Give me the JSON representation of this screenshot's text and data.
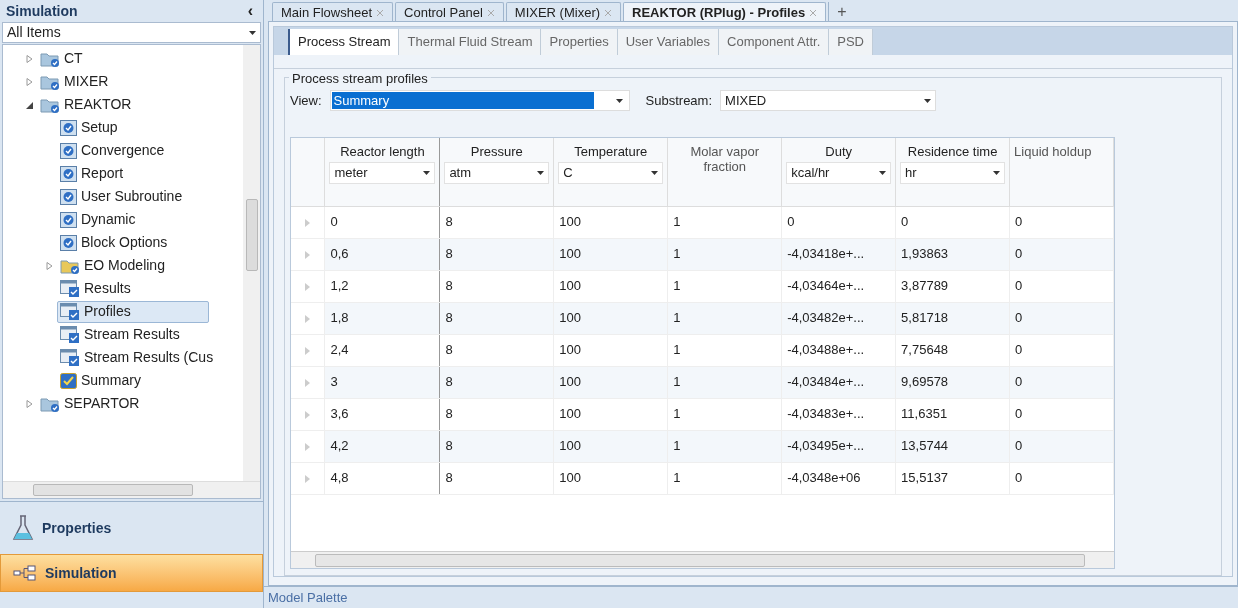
{
  "sidebar": {
    "title": "Simulation",
    "collapse_glyph": "‹",
    "filter": "All Items",
    "tree": [
      {
        "label": "CT",
        "kind": "folder",
        "expanded": false,
        "selected": false
      },
      {
        "label": "MIXER",
        "kind": "folder",
        "expanded": false,
        "selected": false
      },
      {
        "label": "REAKTOR",
        "kind": "folder",
        "expanded": true,
        "selected": false,
        "children": [
          {
            "label": "Setup",
            "kind": "form",
            "selected": false
          },
          {
            "label": "Convergence",
            "kind": "form",
            "selected": false
          },
          {
            "label": "Report",
            "kind": "form",
            "selected": false
          },
          {
            "label": "User Subroutine",
            "kind": "form",
            "selected": false
          },
          {
            "label": "Dynamic",
            "kind": "form",
            "selected": false
          },
          {
            "label": "Block Options",
            "kind": "form",
            "selected": false
          },
          {
            "label": "EO Modeling",
            "kind": "yellow-folder",
            "expanded": false,
            "selected": false
          },
          {
            "label": "Results",
            "kind": "result",
            "selected": false
          },
          {
            "label": "Profiles",
            "kind": "result",
            "selected": true
          },
          {
            "label": "Stream Results",
            "kind": "result",
            "selected": false
          },
          {
            "label": "Stream Results (Cus",
            "kind": "result",
            "selected": false
          },
          {
            "label": "Summary",
            "kind": "summary",
            "selected": false
          }
        ]
      },
      {
        "label": "SEPARTOR",
        "kind": "folder",
        "expanded": false,
        "selected": false
      }
    ],
    "nav": [
      {
        "label": "Properties",
        "kind": "flask",
        "selected": false
      },
      {
        "label": "Simulation",
        "kind": "tree",
        "selected": true
      }
    ]
  },
  "doc_tabs": [
    {
      "label": "Main Flowsheet",
      "selected": false
    },
    {
      "label": "Control Panel",
      "selected": false
    },
    {
      "label": "MIXER (Mixer)",
      "selected": false
    },
    {
      "label": "REAKTOR (RPlug) - Profiles",
      "selected": true
    }
  ],
  "new_tab_glyph": "+",
  "form_tabs": [
    {
      "label": "Process Stream",
      "selected": true
    },
    {
      "label": "Thermal Fluid Stream",
      "selected": false
    },
    {
      "label": "Properties",
      "selected": false
    },
    {
      "label": "User Variables",
      "selected": false
    },
    {
      "label": "Component Attr.",
      "selected": false
    },
    {
      "label": "PSD",
      "selected": false
    }
  ],
  "group": {
    "title": "Process stream profiles",
    "view_label": "View:",
    "view": "Summary",
    "substream_label": "Substream:",
    "substream": "MIXED"
  },
  "table": {
    "columns": [
      {
        "heading": "Reactor length",
        "unit": "meter"
      },
      {
        "heading": "Pressure",
        "unit": "atm"
      },
      {
        "heading": "Temperature",
        "unit": "C"
      },
      {
        "heading": "Molar vapor fraction"
      },
      {
        "heading": "Duty",
        "unit": "kcal/hr"
      },
      {
        "heading": "Residence time",
        "unit": "hr"
      },
      {
        "heading": "Liquid holdup"
      }
    ],
    "rows": [
      [
        "0",
        "8",
        "100",
        "1",
        "0",
        "0",
        "0"
      ],
      [
        "0,6",
        "8",
        "100",
        "1",
        "-4,03418e+...",
        "1,93863",
        "0"
      ],
      [
        "1,2",
        "8",
        "100",
        "1",
        "-4,03464e+...",
        "3,87789",
        "0"
      ],
      [
        "1,8",
        "8",
        "100",
        "1",
        "-4,03482e+...",
        "5,81718",
        "0"
      ],
      [
        "2,4",
        "8",
        "100",
        "1",
        "-4,03488e+...",
        "7,75648",
        "0"
      ],
      [
        "3",
        "8",
        "100",
        "1",
        "-4,03484e+...",
        "9,69578",
        "0"
      ],
      [
        "3,6",
        "8",
        "100",
        "1",
        "-4,03483e+...",
        "11,6351",
        "0"
      ],
      [
        "4,2",
        "8",
        "100",
        "1",
        "-4,03495e+...",
        "13,5744",
        "0"
      ],
      [
        "4,8",
        "8",
        "100",
        "1",
        "-4,0348e+06",
        "15,5137",
        "0"
      ]
    ]
  },
  "status_bar": "Model Palette"
}
